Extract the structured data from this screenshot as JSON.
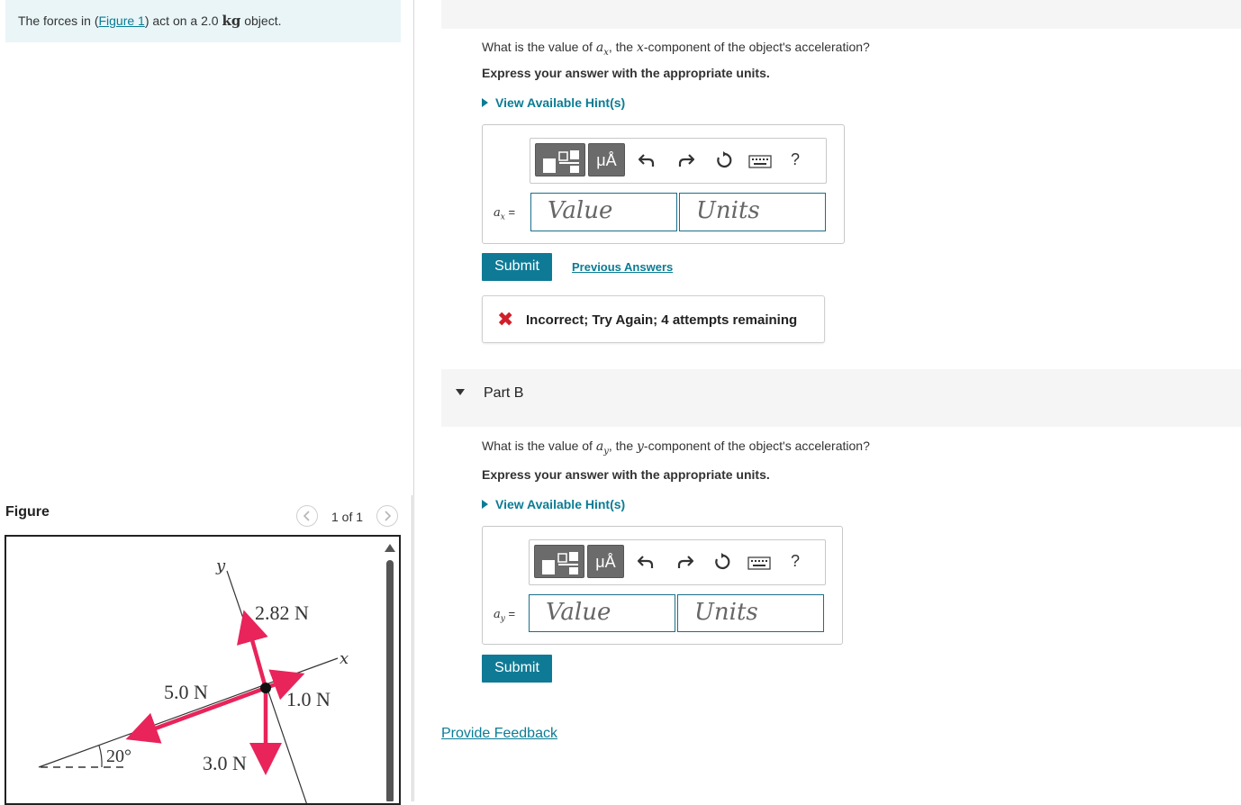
{
  "problem": {
    "text_before": "The forces in (",
    "figure_link": "Figure 1",
    "text_middle": ") act on a 2.0 ",
    "unit": "kg",
    "text_after": " object."
  },
  "figure": {
    "heading": "Figure",
    "counter": "1 of 1",
    "prev_icon": "chevron-left-icon",
    "next_icon": "chevron-right-icon",
    "labels": {
      "y_axis": "y",
      "x_axis": "x",
      "force_up": "2.82 N",
      "force_right": "1.0 N",
      "force_left": "5.0 N",
      "force_down": "3.0 N",
      "angle": "20°"
    },
    "colors": {
      "arrow": "#e8245a",
      "axis": "#333333",
      "body": "#111111"
    }
  },
  "part_a": {
    "question_pre": "What is the value of ",
    "question_var": "a",
    "question_sub": "x",
    "question_mid": ", the ",
    "question_axis": "x",
    "question_post": "-component of the object's acceleration?",
    "instruction": "Express your answer with the appropriate units.",
    "hint_label": "View Available Hint(s)",
    "var_label": "a",
    "var_sub": "x",
    "value_placeholder": "Value",
    "units_placeholder": "Units",
    "submit_label": "Submit",
    "previous_answers_label": "Previous Answers",
    "feedback": "Incorrect; Try Again; 4 attempts remaining"
  },
  "part_b": {
    "title": "Part B",
    "question_pre": "What is the value of ",
    "question_var": "a",
    "question_sub": "y",
    "question_mid": ", the ",
    "question_axis": "y",
    "question_post": "-component of the object's acceleration?",
    "instruction": "Express your answer with the appropriate units.",
    "hint_label": "View Available Hint(s)",
    "var_label": "a",
    "var_sub": "y",
    "value_placeholder": "Value",
    "units_placeholder": "Units",
    "submit_label": "Submit"
  },
  "toolbar": {
    "units_symbol": "μÅ",
    "help_label": "?",
    "icons": [
      "templates-icon",
      "units-icon",
      "undo-icon",
      "redo-icon",
      "reset-icon",
      "keyboard-icon",
      "help-icon"
    ]
  },
  "footer": {
    "provide_feedback": "Provide Feedback"
  }
}
